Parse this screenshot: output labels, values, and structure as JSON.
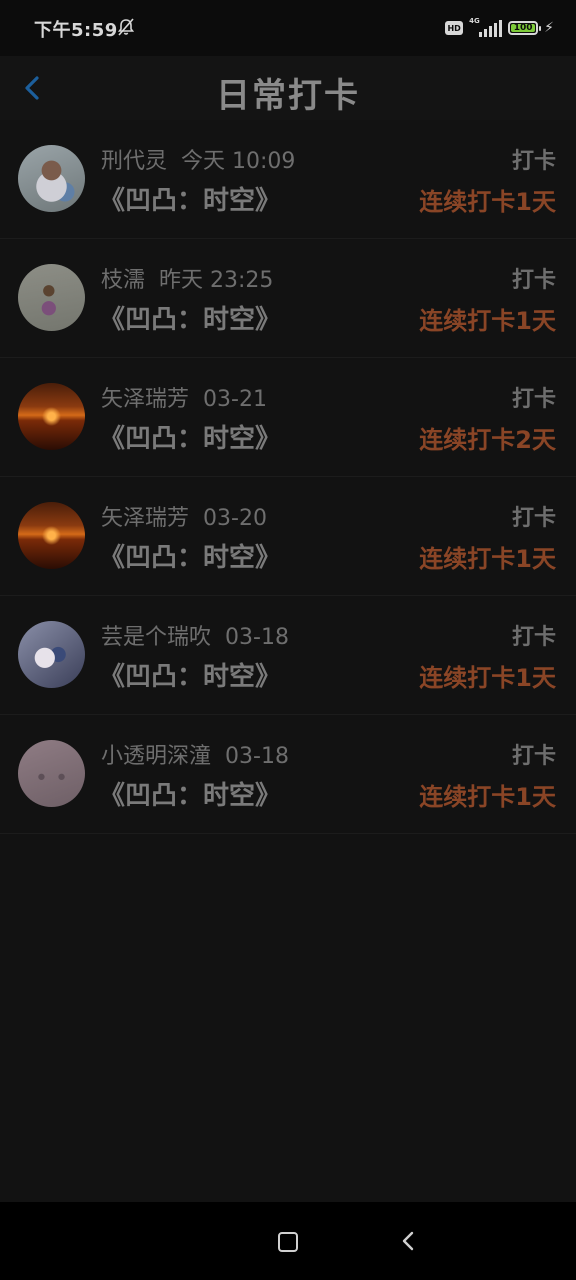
{
  "status_bar": {
    "time": "下午5:59",
    "hd": "HD",
    "network": "4G",
    "battery": "100"
  },
  "header": {
    "title": "日常打卡"
  },
  "entries": [
    {
      "user": "刑代灵",
      "time": "今天 10:09",
      "book": "《凹凸：时空》",
      "action": "打卡",
      "streak": "连续打卡1天",
      "avatar": "girl-photo"
    },
    {
      "user": "枝濡",
      "time": "昨天 23:25",
      "book": "《凹凸：时空》",
      "action": "打卡",
      "streak": "连续打卡1天",
      "avatar": "child-photo"
    },
    {
      "user": "矢泽瑞芳",
      "time": "03-21",
      "book": "《凹凸：时空》",
      "action": "打卡",
      "streak": "连续打卡2天",
      "avatar": "sunset-photo"
    },
    {
      "user": "矢泽瑞芳",
      "time": "03-20",
      "book": "《凹凸：时空》",
      "action": "打卡",
      "streak": "连续打卡1天",
      "avatar": "sunset-photo"
    },
    {
      "user": "芸是个瑞吹",
      "time": "03-18",
      "book": "《凹凸：时空》",
      "action": "打卡",
      "streak": "连续打卡1天",
      "avatar": "anime-photo"
    },
    {
      "user": "小透明深潼",
      "time": "03-18",
      "book": "《凹凸：时空》",
      "action": "打卡",
      "streak": "连续打卡1天",
      "avatar": "pink-photo"
    }
  ],
  "colors": {
    "background": "#121212",
    "streak": "#8a4526",
    "back_arrow": "#1c5f9c"
  }
}
